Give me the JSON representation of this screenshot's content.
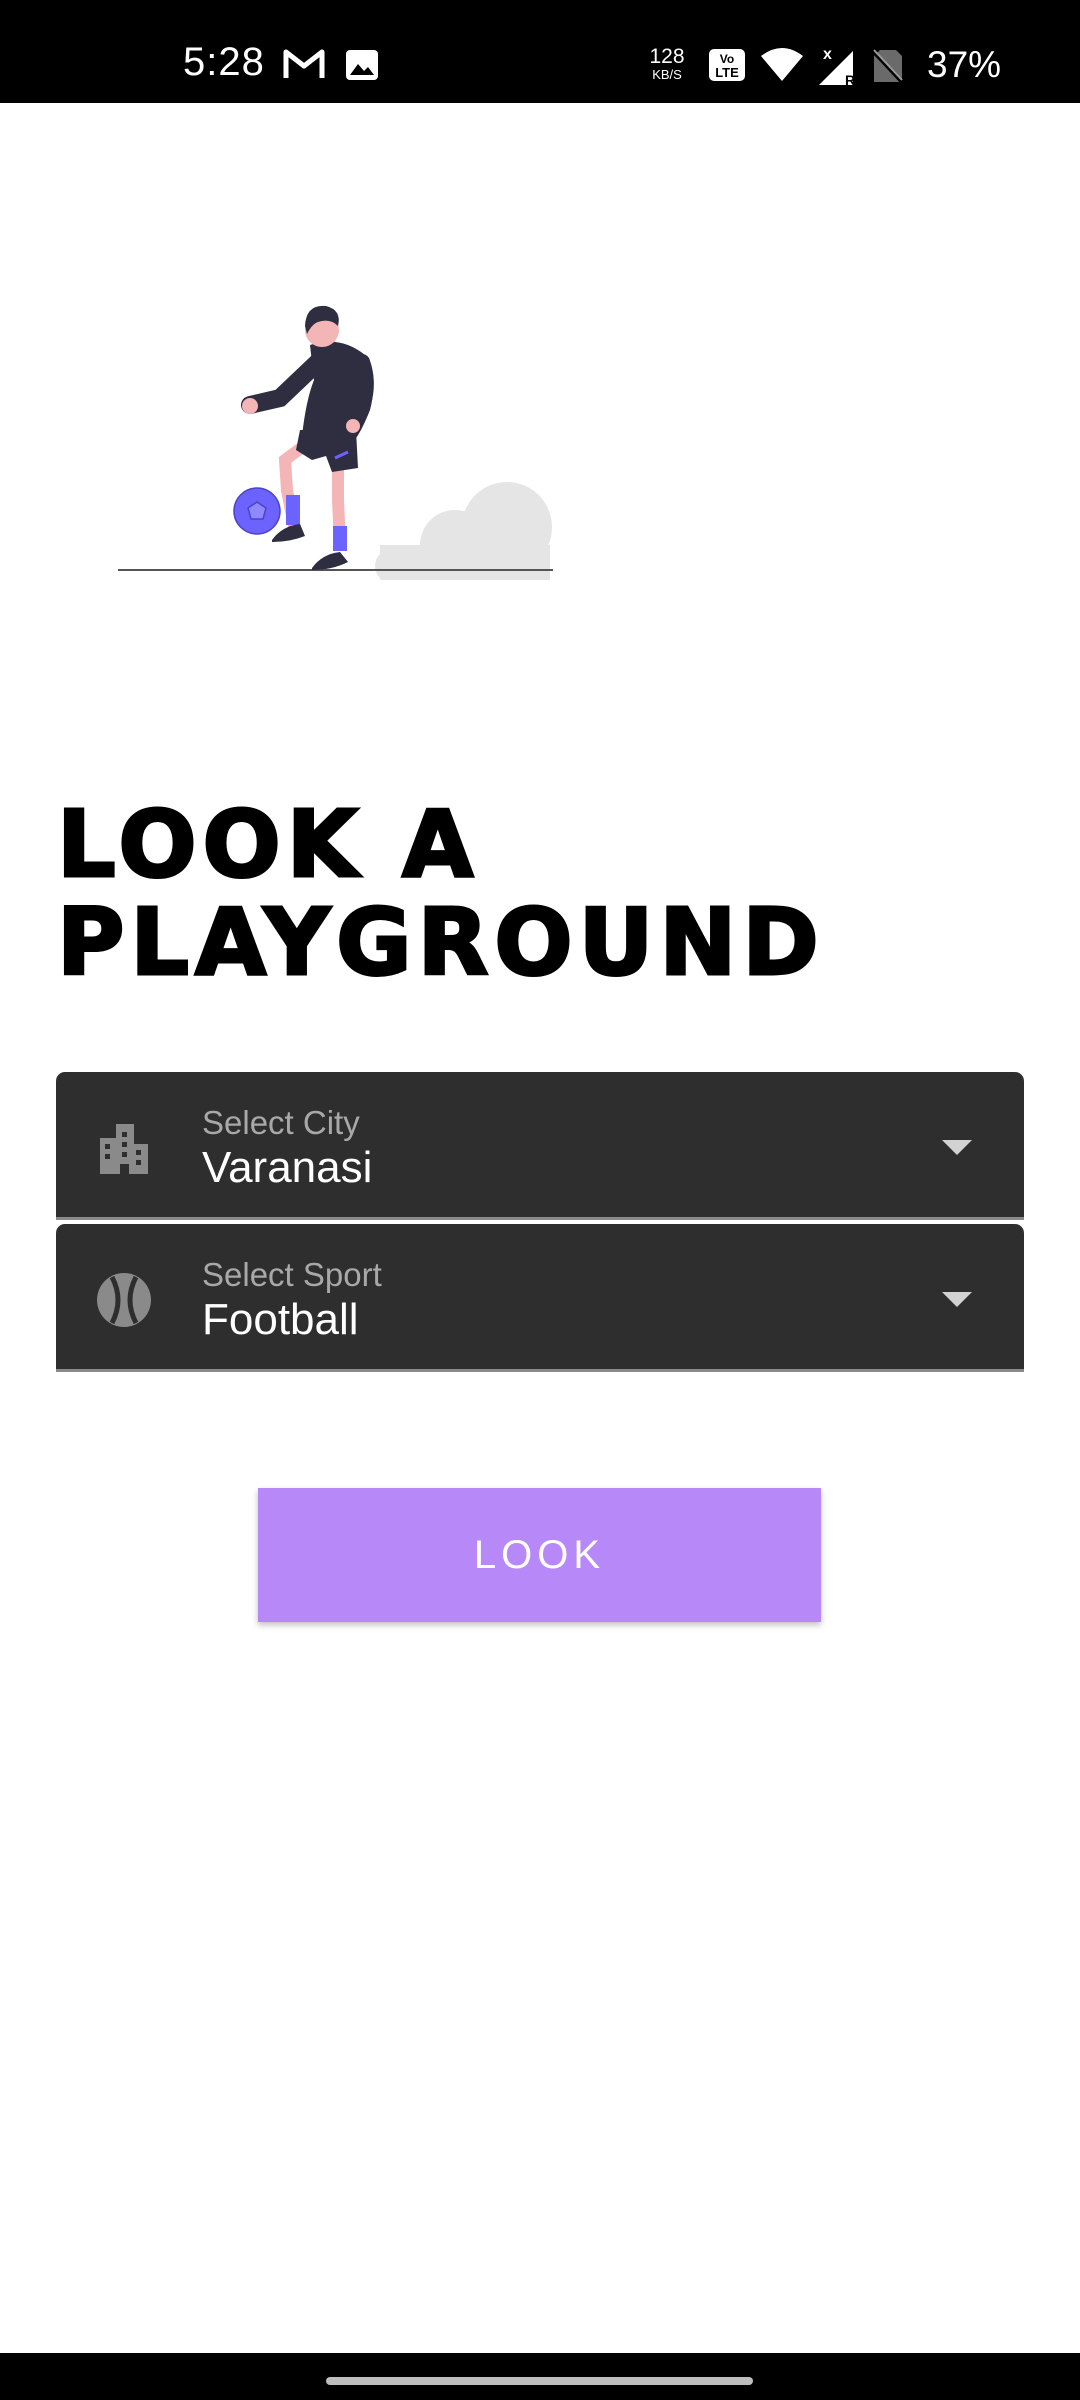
{
  "status_bar": {
    "time": "5:28",
    "net_speed_value": "128",
    "net_speed_unit": "KB/S",
    "volte": "VoLTE",
    "battery": "37%",
    "icons": [
      "gmail-icon",
      "image-icon",
      "volte-icon",
      "wifi-icon",
      "signal-icon",
      "no-sim-icon"
    ]
  },
  "hero": {
    "illustration": "football-player-illustration",
    "accent_color": "#6c63ff"
  },
  "main": {
    "title": "LOOK A PLAYGROUND",
    "city_field": {
      "label": "Select City",
      "value": "Varanasi",
      "icon": "city-icon"
    },
    "sport_field": {
      "label": "Select Sport",
      "value": "Football",
      "icon": "sports-ball-icon"
    },
    "look_button_label": "LOOK"
  },
  "colors": {
    "button": "#b788f8",
    "field_background": "#2e2e2e",
    "title": "#000000"
  }
}
